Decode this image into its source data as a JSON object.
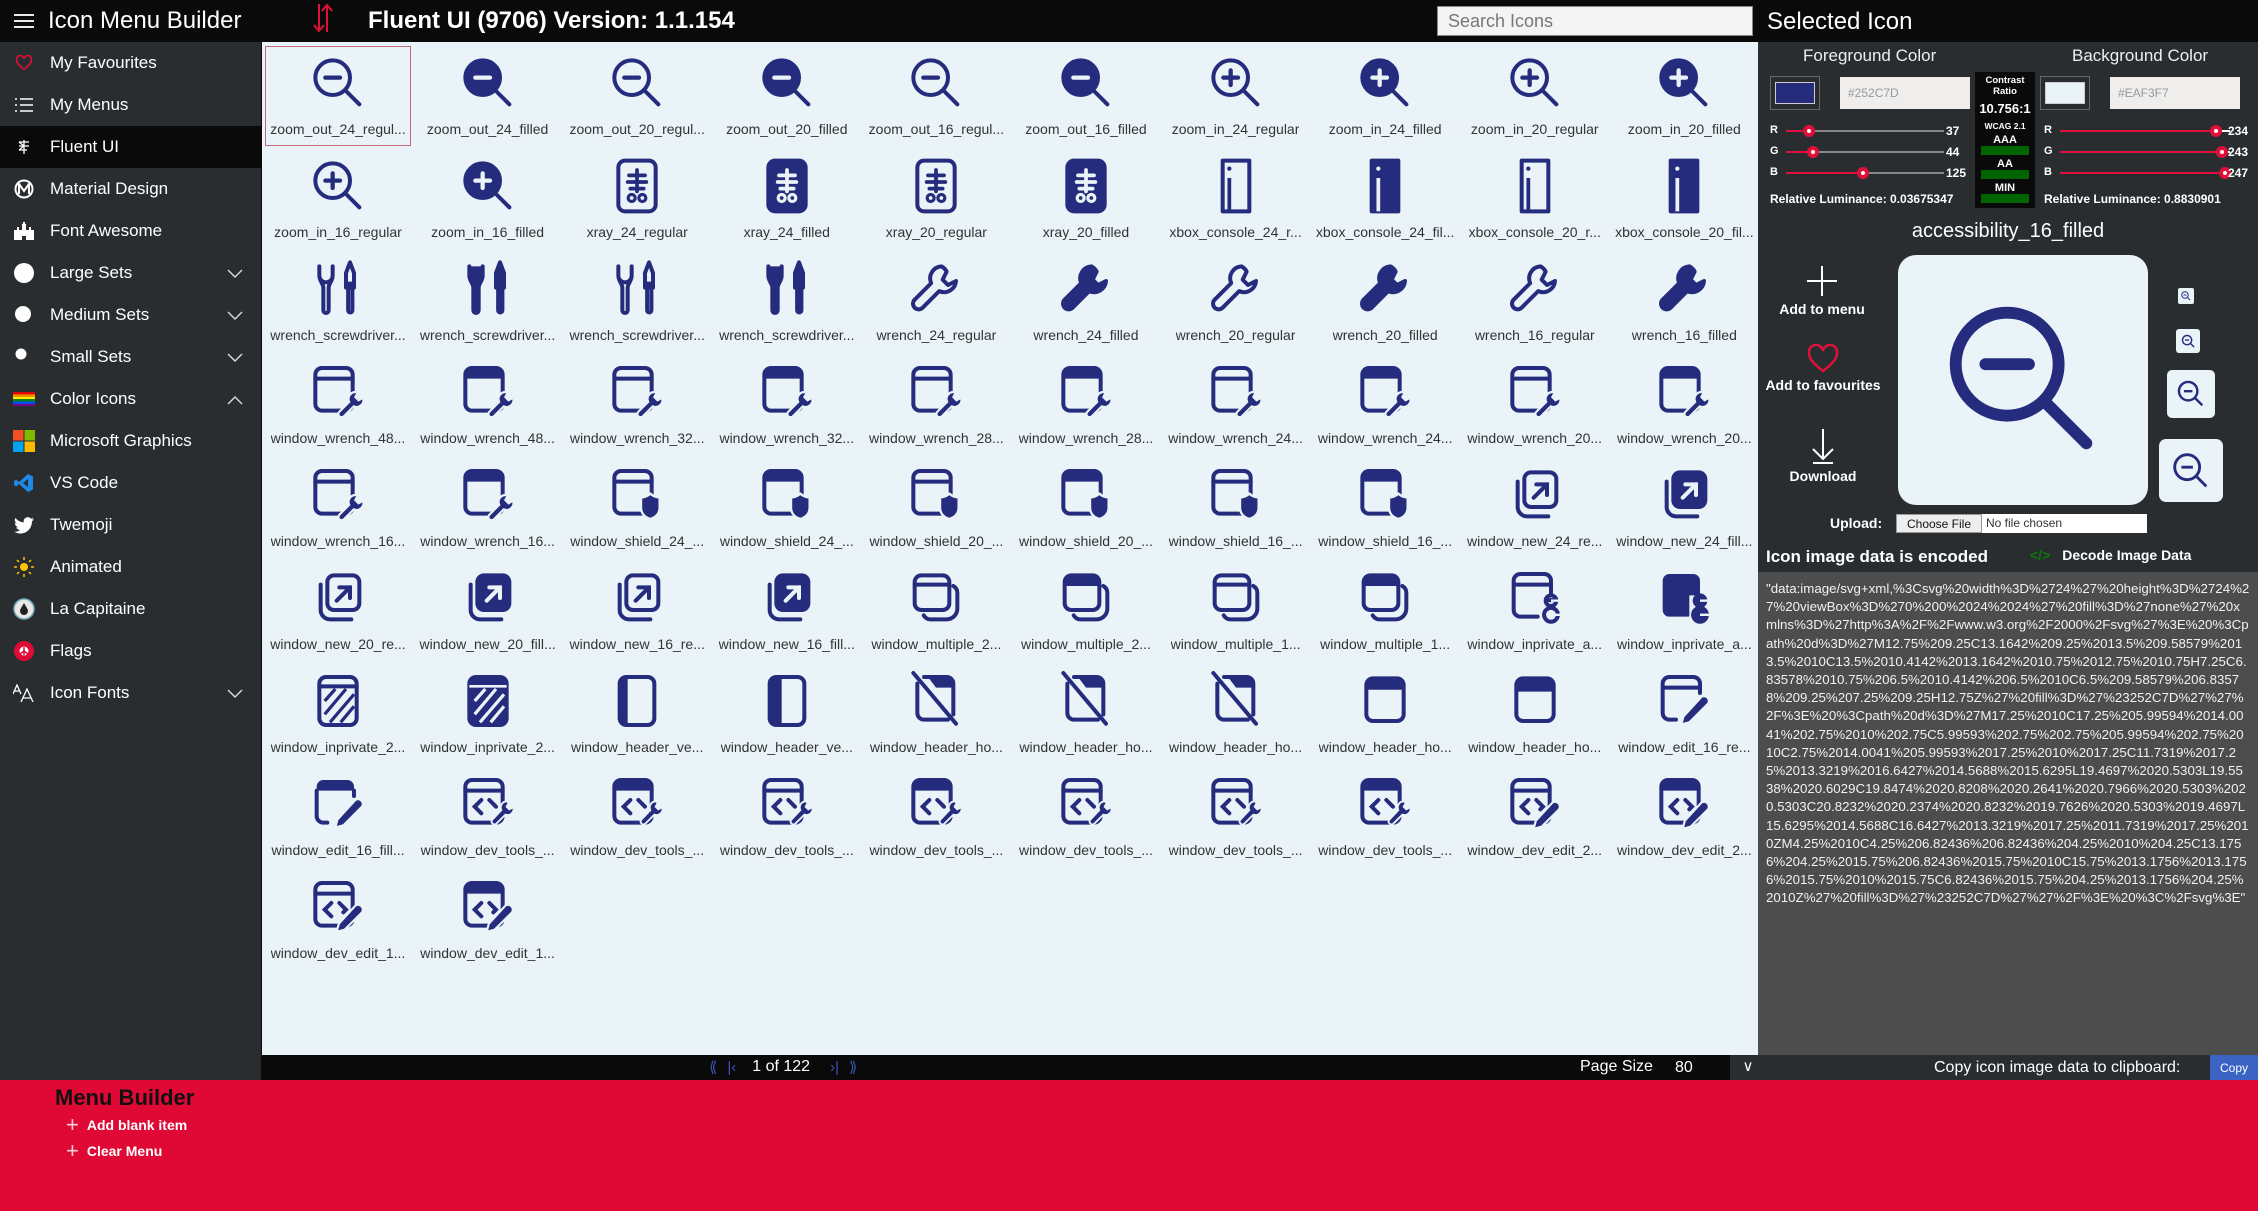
{
  "header": {
    "app_title": "Icon Menu Builder",
    "library_title": "Fluent UI (9706) Version: 1.1.154",
    "search_placeholder": "Search Icons",
    "selected_panel_title": "Selected Icon"
  },
  "sidebar": {
    "items": [
      {
        "label": "My Favourites",
        "icon": "heart-icon",
        "active": false,
        "chevron": null
      },
      {
        "label": "My Menus",
        "icon": "list-icon",
        "active": false,
        "chevron": null
      },
      {
        "label": "Fluent UI",
        "icon": "fluent-icon",
        "active": true,
        "chevron": null
      },
      {
        "label": "Material Design",
        "icon": "material-design-icon",
        "active": false,
        "chevron": null
      },
      {
        "label": "Font Awesome",
        "icon": "font-awesome-icon",
        "active": false,
        "chevron": null
      },
      {
        "label": "Large Sets",
        "icon": "large-circle-icon",
        "active": false,
        "chevron": "down"
      },
      {
        "label": "Medium Sets",
        "icon": "medium-circle-icon",
        "active": false,
        "chevron": "down"
      },
      {
        "label": "Small Sets",
        "icon": "small-circle-icon",
        "active": false,
        "chevron": "down"
      },
      {
        "label": "Color Icons",
        "icon": "rainbow-flag-icon",
        "active": false,
        "chevron": "up"
      },
      {
        "label": "Microsoft Graphics",
        "icon": "microsoft-logo-icon",
        "active": false,
        "chevron": null
      },
      {
        "label": "VS Code",
        "icon": "vscode-icon",
        "active": false,
        "chevron": null
      },
      {
        "label": "Twemoji",
        "icon": "twitter-bird-icon",
        "active": false,
        "chevron": null
      },
      {
        "label": "Animated",
        "icon": "sun-icon",
        "active": false,
        "chevron": null
      },
      {
        "label": "La Capitaine",
        "icon": "la-capitaine-icon",
        "active": false,
        "chevron": null
      },
      {
        "label": "Flags",
        "icon": "flag-icon",
        "active": false,
        "chevron": null
      },
      {
        "label": "Icon Fonts",
        "icon": "font-size-icon",
        "active": false,
        "chevron": "down"
      }
    ]
  },
  "grid": {
    "selected_index": 0,
    "icons": [
      {
        "label": "zoom_out_24_regul...",
        "glyph": "zoom-out",
        "filled": false
      },
      {
        "label": "zoom_out_24_filled",
        "glyph": "zoom-out",
        "filled": true
      },
      {
        "label": "zoom_out_20_regul...",
        "glyph": "zoom-out",
        "filled": false
      },
      {
        "label": "zoom_out_20_filled",
        "glyph": "zoom-out",
        "filled": true
      },
      {
        "label": "zoom_out_16_regul...",
        "glyph": "zoom-out",
        "filled": false
      },
      {
        "label": "zoom_out_16_filled",
        "glyph": "zoom-out",
        "filled": true
      },
      {
        "label": "zoom_in_24_regular",
        "glyph": "zoom-in",
        "filled": false
      },
      {
        "label": "zoom_in_24_filled",
        "glyph": "zoom-in",
        "filled": true
      },
      {
        "label": "zoom_in_20_regular",
        "glyph": "zoom-in",
        "filled": false
      },
      {
        "label": "zoom_in_20_filled",
        "glyph": "zoom-in",
        "filled": true
      },
      {
        "label": "zoom_in_16_regular",
        "glyph": "zoom-in",
        "filled": false
      },
      {
        "label": "zoom_in_16_filled",
        "glyph": "zoom-in",
        "filled": true
      },
      {
        "label": "xray_24_regular",
        "glyph": "xray",
        "filled": false
      },
      {
        "label": "xray_24_filled",
        "glyph": "xray",
        "filled": true
      },
      {
        "label": "xray_20_regular",
        "glyph": "xray",
        "filled": false
      },
      {
        "label": "xray_20_filled",
        "glyph": "xray",
        "filled": true
      },
      {
        "label": "xbox_console_24_r...",
        "glyph": "xbox-console",
        "filled": false
      },
      {
        "label": "xbox_console_24_fil...",
        "glyph": "xbox-console",
        "filled": true
      },
      {
        "label": "xbox_console_20_r...",
        "glyph": "xbox-console",
        "filled": false
      },
      {
        "label": "xbox_console_20_fil...",
        "glyph": "xbox-console",
        "filled": true
      },
      {
        "label": "wrench_screwdriver...",
        "glyph": "wrench-screwdriver",
        "filled": false
      },
      {
        "label": "wrench_screwdriver...",
        "glyph": "wrench-screwdriver",
        "filled": true
      },
      {
        "label": "wrench_screwdriver...",
        "glyph": "wrench-screwdriver",
        "filled": false
      },
      {
        "label": "wrench_screwdriver...",
        "glyph": "wrench-screwdriver",
        "filled": true
      },
      {
        "label": "wrench_24_regular",
        "glyph": "wrench",
        "filled": false
      },
      {
        "label": "wrench_24_filled",
        "glyph": "wrench",
        "filled": true
      },
      {
        "label": "wrench_20_regular",
        "glyph": "wrench",
        "filled": false
      },
      {
        "label": "wrench_20_filled",
        "glyph": "wrench",
        "filled": true
      },
      {
        "label": "wrench_16_regular",
        "glyph": "wrench",
        "filled": false
      },
      {
        "label": "wrench_16_filled",
        "glyph": "wrench",
        "filled": true
      },
      {
        "label": "window_wrench_48...",
        "glyph": "window-wrench",
        "filled": false
      },
      {
        "label": "window_wrench_48...",
        "glyph": "window-wrench",
        "filled": true
      },
      {
        "label": "window_wrench_32...",
        "glyph": "window-wrench",
        "filled": false
      },
      {
        "label": "window_wrench_32...",
        "glyph": "window-wrench",
        "filled": true
      },
      {
        "label": "window_wrench_28...",
        "glyph": "window-wrench",
        "filled": false
      },
      {
        "label": "window_wrench_28...",
        "glyph": "window-wrench",
        "filled": true
      },
      {
        "label": "window_wrench_24...",
        "glyph": "window-wrench",
        "filled": false
      },
      {
        "label": "window_wrench_24...",
        "glyph": "window-wrench",
        "filled": true
      },
      {
        "label": "window_wrench_20...",
        "glyph": "window-wrench",
        "filled": false
      },
      {
        "label": "window_wrench_20...",
        "glyph": "window-wrench",
        "filled": true
      },
      {
        "label": "window_wrench_16...",
        "glyph": "window-wrench",
        "filled": false
      },
      {
        "label": "window_wrench_16...",
        "glyph": "window-wrench",
        "filled": true
      },
      {
        "label": "window_shield_24_...",
        "glyph": "window-shield",
        "filled": false
      },
      {
        "label": "window_shield_24_...",
        "glyph": "window-shield",
        "filled": true
      },
      {
        "label": "window_shield_20_...",
        "glyph": "window-shield",
        "filled": false
      },
      {
        "label": "window_shield_20_...",
        "glyph": "window-shield",
        "filled": true
      },
      {
        "label": "window_shield_16_...",
        "glyph": "window-shield",
        "filled": false
      },
      {
        "label": "window_shield_16_...",
        "glyph": "window-shield",
        "filled": true
      },
      {
        "label": "window_new_24_re...",
        "glyph": "window-new",
        "filled": false
      },
      {
        "label": "window_new_24_fill...",
        "glyph": "window-new",
        "filled": true
      },
      {
        "label": "window_new_20_re...",
        "glyph": "window-new",
        "filled": false
      },
      {
        "label": "window_new_20_fill...",
        "glyph": "window-new",
        "filled": true
      },
      {
        "label": "window_new_16_re...",
        "glyph": "window-new",
        "filled": false
      },
      {
        "label": "window_new_16_fill...",
        "glyph": "window-new",
        "filled": true
      },
      {
        "label": "window_multiple_2...",
        "glyph": "window-multiple",
        "filled": false
      },
      {
        "label": "window_multiple_2...",
        "glyph": "window-multiple",
        "filled": true
      },
      {
        "label": "window_multiple_1...",
        "glyph": "window-multiple",
        "filled": false
      },
      {
        "label": "window_multiple_1...",
        "glyph": "window-multiple",
        "filled": true
      },
      {
        "label": "window_inprivate_a...",
        "glyph": "window-inprivate-account",
        "filled": false
      },
      {
        "label": "window_inprivate_a...",
        "glyph": "window-inprivate-account",
        "filled": true
      },
      {
        "label": "window_inprivate_2...",
        "glyph": "window-inprivate",
        "filled": false
      },
      {
        "label": "window_inprivate_2...",
        "glyph": "window-inprivate",
        "filled": true
      },
      {
        "label": "window_header_ve...",
        "glyph": "window-header-vertical",
        "filled": false
      },
      {
        "label": "window_header_ve...",
        "glyph": "window-header-vertical",
        "filled": true
      },
      {
        "label": "window_header_ho...",
        "glyph": "window-header-horizontal-off",
        "filled": false
      },
      {
        "label": "window_header_ho...",
        "glyph": "window-header-horizontal-off",
        "filled": true
      },
      {
        "label": "window_header_ho...",
        "glyph": "window-header-horizontal-off",
        "filled": false
      },
      {
        "label": "window_header_ho...",
        "glyph": "window-header-horizontal",
        "filled": false
      },
      {
        "label": "window_header_ho...",
        "glyph": "window-header-horizontal",
        "filled": true
      },
      {
        "label": "window_edit_16_re...",
        "glyph": "window-edit",
        "filled": false
      },
      {
        "label": "window_edit_16_fill...",
        "glyph": "window-edit",
        "filled": true
      },
      {
        "label": "window_dev_tools_...",
        "glyph": "window-dev-tools",
        "filled": false
      },
      {
        "label": "window_dev_tools_...",
        "glyph": "window-dev-tools",
        "filled": true
      },
      {
        "label": "window_dev_tools_...",
        "glyph": "window-dev-tools",
        "filled": false
      },
      {
        "label": "window_dev_tools_...",
        "glyph": "window-dev-tools",
        "filled": true
      },
      {
        "label": "window_dev_tools_...",
        "glyph": "window-dev-tools",
        "filled": false
      },
      {
        "label": "window_dev_tools_...",
        "glyph": "window-dev-tools",
        "filled": false
      },
      {
        "label": "window_dev_tools_...",
        "glyph": "window-dev-tools",
        "filled": true
      },
      {
        "label": "window_dev_edit_2...",
        "glyph": "window-dev-edit",
        "filled": false
      },
      {
        "label": "window_dev_edit_2...",
        "glyph": "window-dev-edit",
        "filled": true
      },
      {
        "label": "window_dev_edit_1...",
        "glyph": "window-dev-edit",
        "filled": false
      },
      {
        "label": "window_dev_edit_1...",
        "glyph": "window-dev-edit",
        "filled": true
      }
    ]
  },
  "pager": {
    "info": "1 of 122",
    "page_size_label": "Page Size",
    "page_size": "80",
    "first_icon": "first-page-icon",
    "prev_icon": "prev-page-icon",
    "next_icon": "next-page-icon",
    "last_icon": "last-page-icon"
  },
  "selected": {
    "name": "accessibility_16_filled",
    "foreground": {
      "title": "Foreground Color",
      "hex": "#252C7D",
      "r": 37,
      "g": 44,
      "b": 125,
      "luminance_label": "Relative Luminance:",
      "luminance": "0.03675347"
    },
    "background": {
      "title": "Background Color",
      "hex": "#EAF3F7",
      "r": 234,
      "g": 243,
      "b": 247,
      "luminance_label": "Relative Luminance:",
      "luminance": "0.8830901"
    },
    "contrast": {
      "title": "Contrast Ratio",
      "ratio": "10.756:1",
      "standard": "WCAG 2.1",
      "levels": [
        "AAA",
        "AA",
        "MIN"
      ],
      "pass_color": "#006400"
    },
    "actions": {
      "add_to_menu": "Add to menu",
      "add_to_favourites": "Add to favourites",
      "download": "Download"
    },
    "upload_label": "Upload:",
    "choose_file": "Choose File",
    "no_file": "No file chosen",
    "encoded_label": "Icon image data is encoded",
    "decode_label": "Decode Image Data",
    "image_data": "\"data:image/svg+xml,%3Csvg%20width%3D%2724%27%20height%3D%2724%27%20viewBox%3D%270%200%2024%2024%27%20fill%3D%27none%27%20xmlns%3D%27http%3A%2F%2Fwww.w3.org%2F2000%2Fsvg%27%3E%20%3Cpath%20d%3D%27M12.75%209.25C13.1642%209.25%2013.5%209.58579%2013.5%2010C13.5%2010.4142%2013.1642%2010.75%2012.75%2010.75H7.25C6.83578%2010.75%206.5%2010.4142%206.5%2010C6.5%209.58579%206.83578%209.25%207.25%209.25H12.75Z%27%20fill%3D%27%23252C7D%27%27%2F%3E%20%3Cpath%20d%3D%27M17.25%2010C17.25%205.99594%2014.0041%202.75%2010%202.75C5.99593%202.75%202.75%205.99594%202.75%2010C2.75%2014.0041%205.99593%2017.25%2010%2017.25C11.7319%2017.25%2013.3219%2016.6427%2014.5688%2015.6295L19.4697%2020.5303L19.5538%2020.6029C19.8474%2020.8208%2020.2641%2020.7966%2020.5303%2020.5303C20.8232%2020.2374%2020.8232%2019.7626%2020.5303%2019.4697L15.6295%2014.5688C16.6427%2013.3219%2017.25%2011.7319%2017.25%2010ZM4.25%2010C4.25%206.82436%206.82436%204.25%2010%204.25C13.1756%204.25%2015.75%206.82436%2015.75%2010C15.75%2013.1756%2013.1756%2015.75%2010%2015.75C6.82436%2015.75%204.25%2013.1756%204.25%2010Z%27%20fill%3D%27%23252C7D%27%27%2F%3E%20%3C%2Fsvg%3E\""
  },
  "copy": {
    "label": "Copy icon image data to clipboard:",
    "button": "Copy"
  },
  "menu_builder": {
    "title": "Menu Builder",
    "add_blank": "Add blank item",
    "clear": "Clear Menu"
  },
  "colors": {
    "accent": "#E00935",
    "icon": "#252C7D",
    "grid_bg": "#EAF3F7",
    "sidebar_bg": "#292D30"
  }
}
